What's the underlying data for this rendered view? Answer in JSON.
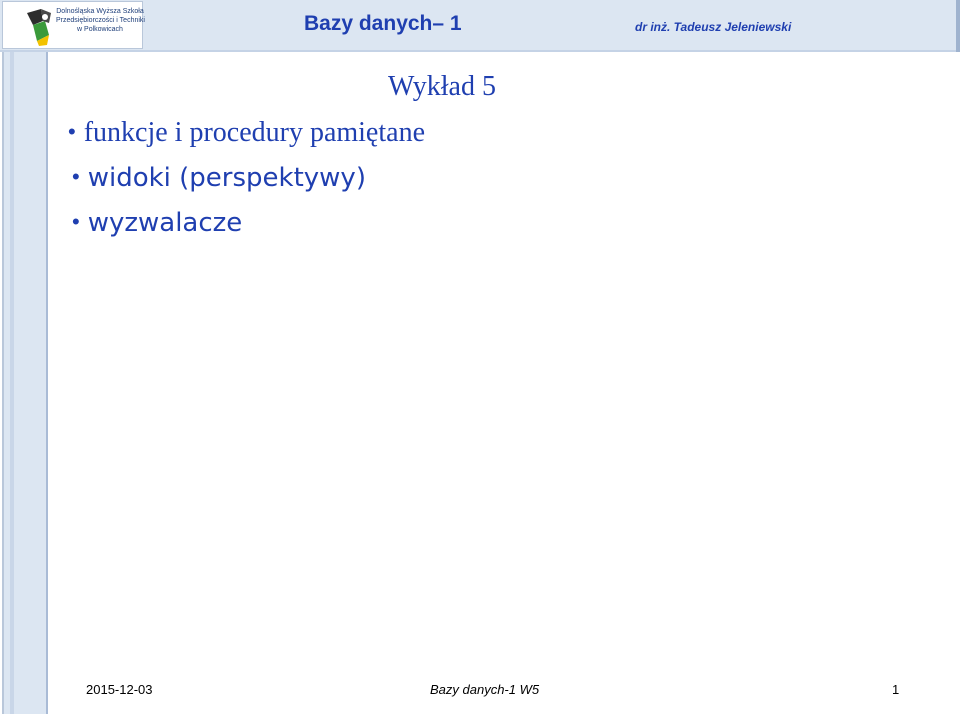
{
  "header": {
    "logo": {
      "lines": [
        "Dolnośląska Wyższa Szkoła",
        "Przedsiębiorczości i Techniki",
        "w Polkowicach"
      ]
    },
    "title": "Bazy danych– 1",
    "author": "dr inż. Tadeusz Jeleniewski"
  },
  "slide": {
    "lecture_title": "Wykład 5",
    "bullets": [
      "funkcje i procedury pamiętane",
      "widoki (perspektywy)",
      "wyzwalacze"
    ]
  },
  "footer": {
    "date": "2015-12-03",
    "center": "Bazy danych-1 W5",
    "page": "1"
  },
  "colors": {
    "accent": "#1f3fb0",
    "band": "#dce6f2"
  }
}
